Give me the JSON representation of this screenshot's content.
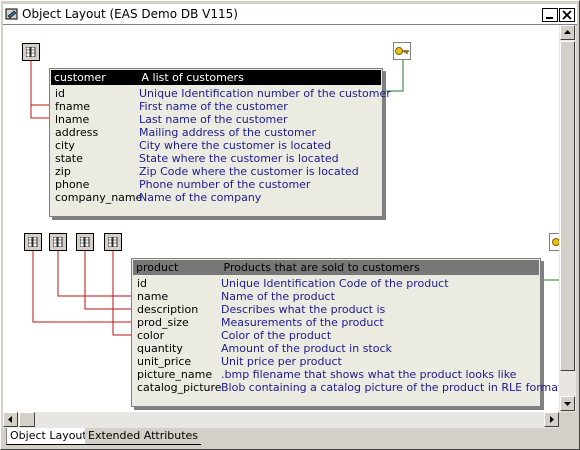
{
  "window": {
    "title": "Object Layout (EAS Demo DB V115)",
    "min_label": "_",
    "max_label": "□",
    "close_label": "✕"
  },
  "colors": {
    "line_red": "#c01010",
    "line_green": "#2a7a2a",
    "header_bg": "#000000",
    "header2_bg": "#777777"
  },
  "customer": {
    "name": "customer",
    "description": "A list of customers",
    "columns": [
      {
        "name": "id",
        "desc": "Unique Identification number of the customer"
      },
      {
        "name": "fname",
        "desc": "First name of the customer"
      },
      {
        "name": "lname",
        "desc": "Last name of the customer"
      },
      {
        "name": "address",
        "desc": "Mailing address of the customer"
      },
      {
        "name": "city",
        "desc": "City where the customer is located"
      },
      {
        "name": "state",
        "desc": "State where the customer is located"
      },
      {
        "name": "zip",
        "desc": "Zip Code where the customer is located"
      },
      {
        "name": "phone",
        "desc": "Phone number of the customer"
      },
      {
        "name": "company_name",
        "desc": "Name of the company"
      }
    ]
  },
  "product": {
    "name": "product",
    "description": "Products that are sold to customers",
    "columns": [
      {
        "name": "id",
        "desc": "Unique Identification Code of the product"
      },
      {
        "name": "name",
        "desc": "Name of the product"
      },
      {
        "name": "description",
        "desc": "Describes what the product is"
      },
      {
        "name": "prod_size",
        "desc": "Measurements of the product"
      },
      {
        "name": "color",
        "desc": "Color of the product"
      },
      {
        "name": "quantity",
        "desc": "Amount of the product in stock"
      },
      {
        "name": "unit_price",
        "desc": "Unit price per product"
      },
      {
        "name": "picture_name",
        "desc": ".bmp filename that shows what the product looks like"
      },
      {
        "name": "catalog_picture",
        "desc": "Blob containing a catalog picture of the product in RLE format"
      }
    ]
  },
  "tabs": [
    {
      "label": "Object Layout",
      "active": true
    },
    {
      "label": "Extended Attributes",
      "active": false
    }
  ]
}
